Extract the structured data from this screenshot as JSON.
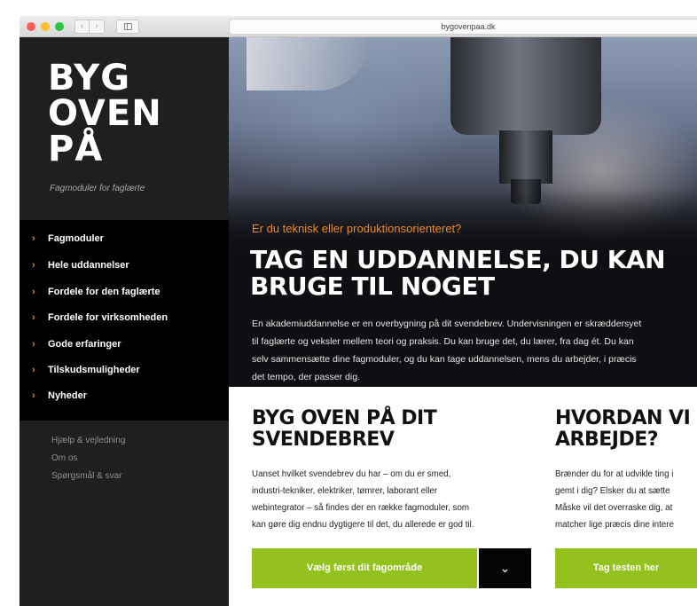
{
  "browser": {
    "url": "bygovenpaa.dk",
    "back_glyph": "‹",
    "forward_glyph": "›"
  },
  "logo": {
    "line1": "BYG",
    "line2": "OVEN",
    "line3": "PÅ",
    "tagline": "Fagmoduler for faglærte"
  },
  "sidebar": {
    "items": [
      {
        "label": "Fagmoduler"
      },
      {
        "label": "Hele uddannelser"
      },
      {
        "label": "Fordele for den faglærte"
      },
      {
        "label": "Fordele for virksomheden"
      },
      {
        "label": "Gode erfaringer"
      },
      {
        "label": "Tilskudsmuligheder"
      },
      {
        "label": "Nyheder"
      }
    ],
    "secondary": [
      {
        "label": "Hjælp & vejledning"
      },
      {
        "label": "Om os"
      },
      {
        "label": "Spørgsmål & svar"
      }
    ]
  },
  "hero": {
    "kicker": "Er du teknisk eller produktionsorienteret?",
    "title": "TAG EN UDDANNELSE, DU KAN BRUGE TIL NOGET",
    "text": "En akademiuddannelse er en overbygning på dit svendebrev. Undervisningen er skræddersyet til faglærte og veksler mellem teori og praksis. Du kan bruge det, du lærer, fra dag ét. Du kan selv sammensætte dine fagmoduler, og du kan tage uddannelsen, mens du arbejder, i præcis det tempo, der passer dig."
  },
  "section1": {
    "title_line1": "BYG OVEN PÅ DIT",
    "title_line2": "SVENDEBREV",
    "lines": [
      "Uanset hvilket svendebrev du har – om du er smed,",
      "industri-tekniker, elektriker, tømrer, laborant eller",
      "webintegrator – så findes der en række fagmoduler, som",
      "kan gøre dig endnu dygtigere til det, du allerede er god til."
    ],
    "cta": "Vælg først dit fagområde",
    "dropdown_glyph": "⌄"
  },
  "section2": {
    "title_line1": "HVORDAN VI",
    "title_line2": "ARBEJDE?",
    "lines": [
      "Brænder du for at udvikle ting i",
      "gemt i dig? Elsker du at sætte",
      "Måske vil det overraske dig, at",
      "matcher lige præcis dine intere"
    ],
    "cta": "Tag testen her"
  },
  "colors": {
    "accent_orange": "#f08a1c",
    "cta_green": "#95c11f",
    "sidebar_bg": "#1f1f1f",
    "menu_bg": "#000000"
  }
}
